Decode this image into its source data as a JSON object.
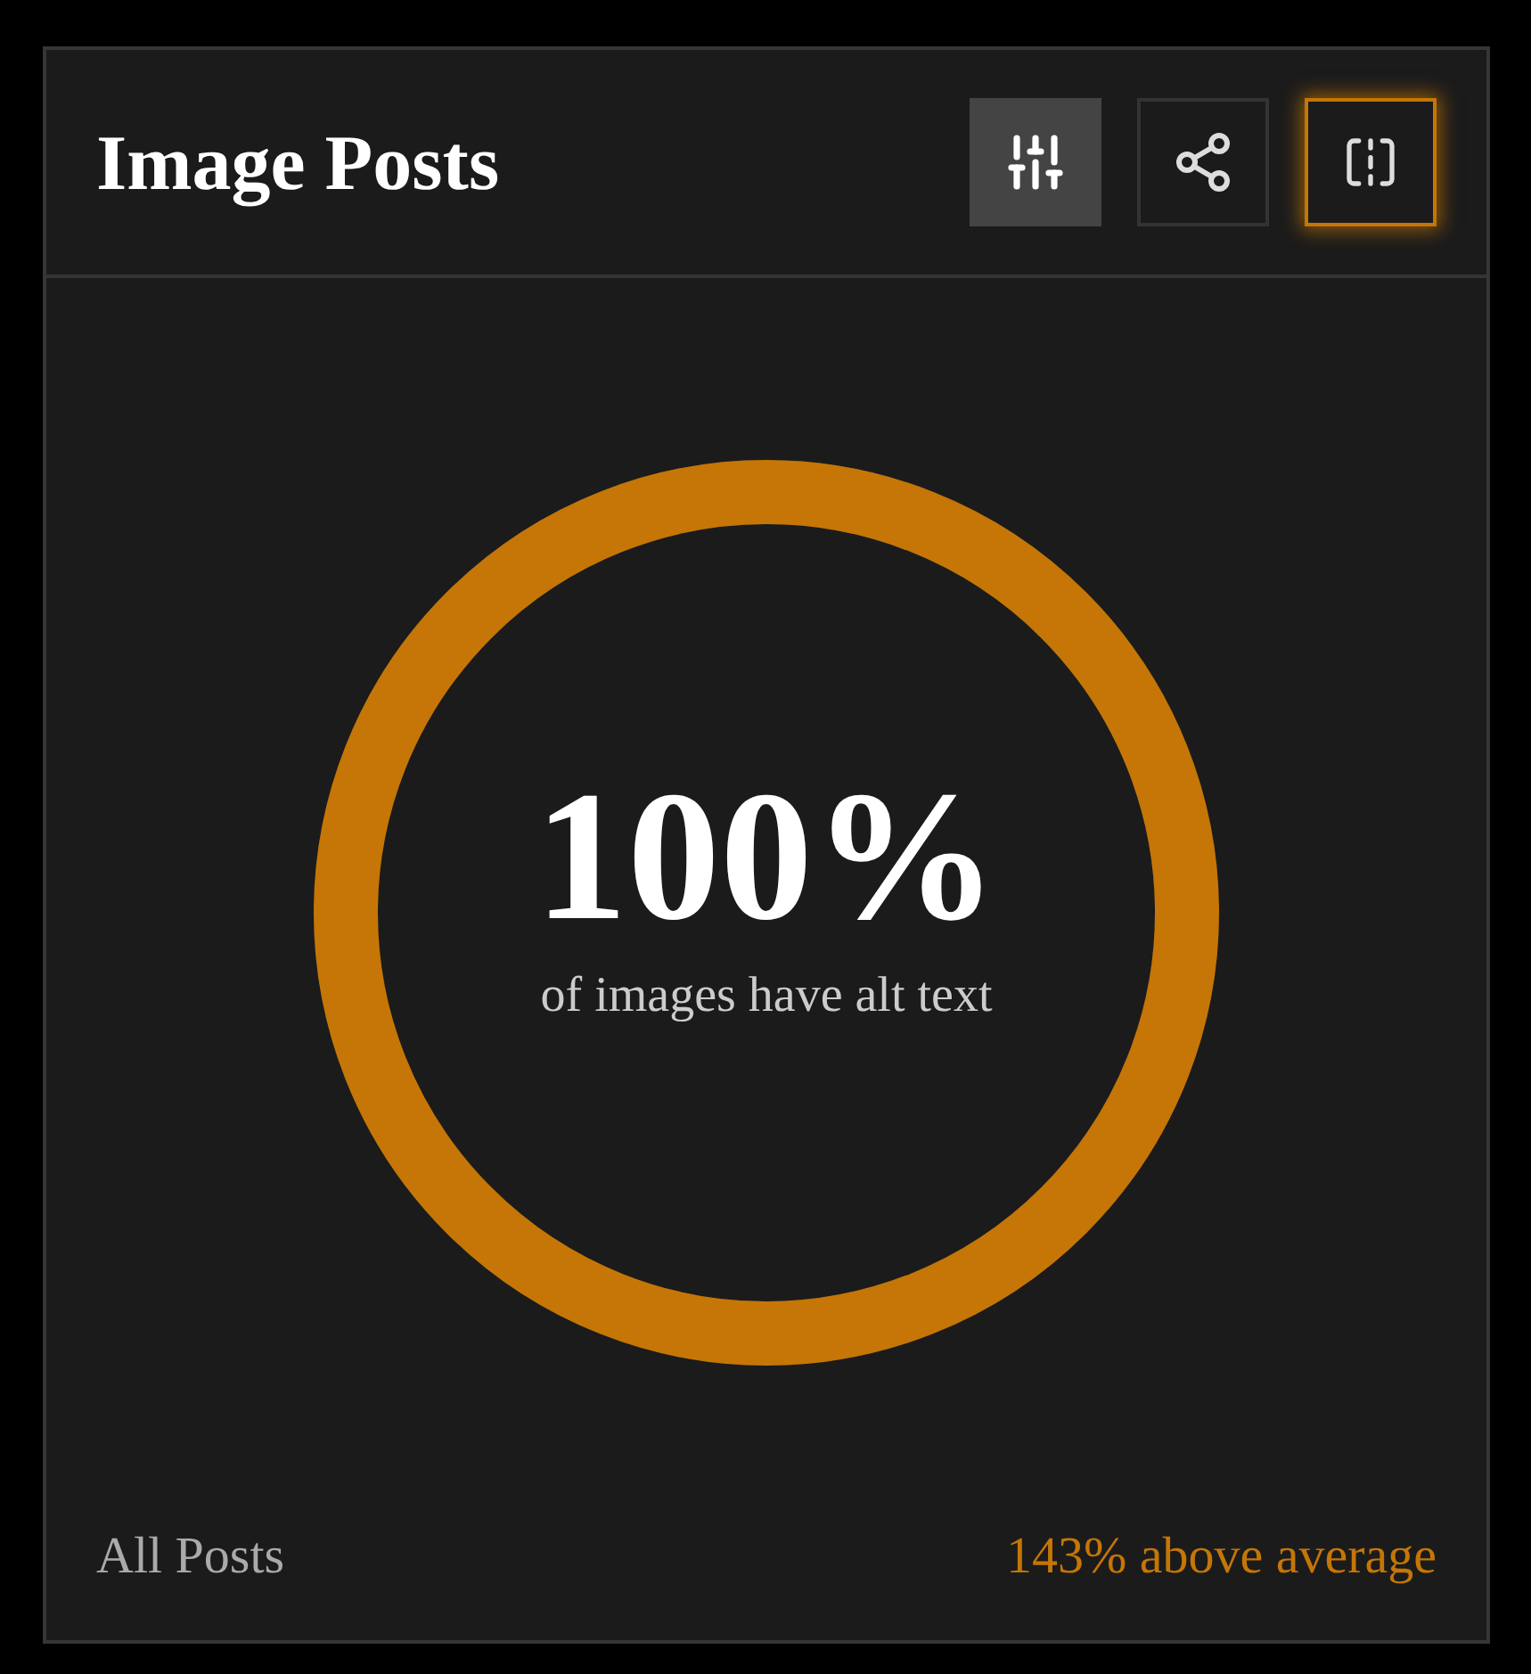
{
  "card": {
    "title": "Image Posts",
    "buttons": [
      {
        "kind": "filter",
        "active": true,
        "focused": false
      },
      {
        "kind": "share",
        "active": false,
        "focused": false
      },
      {
        "kind": "compare",
        "active": false,
        "focused": true
      }
    ],
    "ring": {
      "level": 1,
      "value": "100%",
      "caption": "of images have alt text"
    },
    "footer": {
      "label": "All Posts",
      "comparison": "143% above average"
    }
  }
}
